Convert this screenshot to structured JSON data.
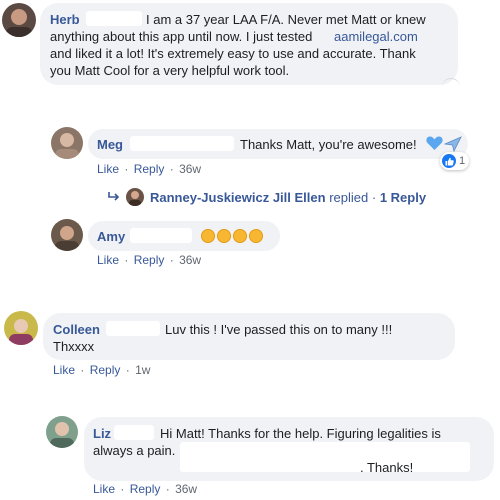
{
  "comments": [
    {
      "name": "Herb",
      "lines": [
        "I am a 37 year LAA F/A. Never met Matt or knew",
        "anything about this app until now. I just tested",
        "and liked it a lot! It's extremely easy to use and accurate. Thank",
        "you Matt Cool for a very helpful work tool."
      ],
      "link": "aamilegal.com"
    },
    {
      "name": "Meg",
      "text": "Thanks Matt, you're awesome!",
      "actions": {
        "like": "Like",
        "reply": "Reply",
        "time": "36w"
      },
      "reaction_count": "1",
      "replied": {
        "name": "Ranney-Juskiewicz Jill Ellen",
        "verb": "replied",
        "count": "1 Reply"
      }
    },
    {
      "name": "Amy",
      "actions": {
        "like": "Like",
        "reply": "Reply",
        "time": "36w"
      }
    },
    {
      "name": "Colleen",
      "lines": [
        "Luv this ! I've passed this on to many !!!",
        "Thxxxx"
      ],
      "actions": {
        "like": "Like",
        "reply": "Reply",
        "time": "1w"
      }
    },
    {
      "name": "Liz",
      "lines": [
        "Hi Matt! Thanks for the help. Figuring legalities is",
        "always a pain.",
        ". Thanks!"
      ],
      "actions": {
        "like": "Like",
        "reply": "Reply",
        "time": "36w"
      }
    }
  ],
  "separator": "·",
  "colors": {
    "link": "#385898",
    "bubble": "#f0f2f5",
    "like_blue": "#1877f2",
    "heart": "#5aa7f0"
  }
}
